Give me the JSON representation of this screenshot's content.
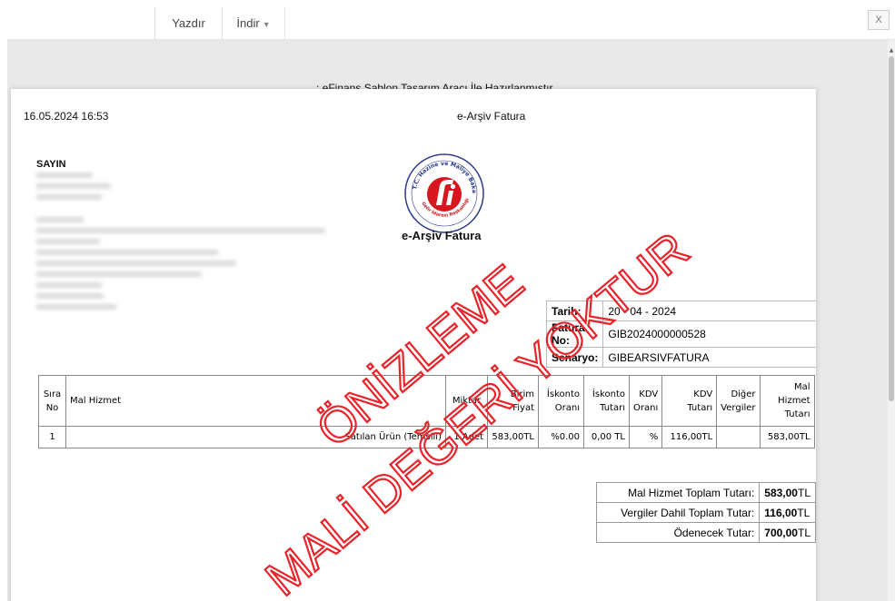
{
  "toolbar": {
    "print_label": "Yazdır",
    "download_label": "İndir",
    "close_label": "X"
  },
  "viewer": {
    "top_note": ": eFinans Şablon Tasarım Aracı İle Hazırlanmıştır."
  },
  "invoice": {
    "datetime": "16.05.2024 16:53",
    "title": "e-Arşiv Fatura",
    "sayin": "SAYIN",
    "logo_title": "e-Arşiv Fatura",
    "logo_text": "T.C. Hazine ve Maliye Bakanlığı · Gelir İdaresi Başkanlığı",
    "info": [
      {
        "label": "Tarih:",
        "value": "20 - 04 - 2024"
      },
      {
        "label": "Fatura No:",
        "value": "GIB2024000000528"
      },
      {
        "label": "Senaryo:",
        "value": "GIBEARSIVFATURA"
      }
    ],
    "items": {
      "headers": [
        "Sıra No",
        "Mal Hizmet",
        "Miktar",
        "Birim Fiyat",
        "İskonto Oranı",
        "İskonto Tutarı",
        "KDV Oranı",
        "KDV Tutarı",
        "Diğer Vergiler",
        "Mal Hizmet Tutarı"
      ],
      "rows": [
        [
          "1",
          "Satılan Ürün (Temsili)",
          "1 Adet",
          "583,00TL",
          "%0.00",
          "0,00 TL",
          "%",
          "116,00TL",
          "",
          "583,00TL"
        ]
      ]
    },
    "totals": [
      {
        "label": "Mal Hizmet Toplam Tutarı:",
        "value": "583,00",
        "unit": "TL"
      },
      {
        "label": "Vergiler Dahil Toplam Tutar:",
        "value": "116,00",
        "unit": "TL"
      },
      {
        "label": "Ödenecek Tutar:",
        "value": "700,00",
        "unit": "TL"
      }
    ],
    "watermark_line1": "ÖNİZLEME",
    "watermark_line2": "MALİ DEĞERİ YOKTUR"
  },
  "colors": {
    "watermark": "#e8232a",
    "logo_red": "#d7161f",
    "logo_text": "#2b3a8c"
  }
}
